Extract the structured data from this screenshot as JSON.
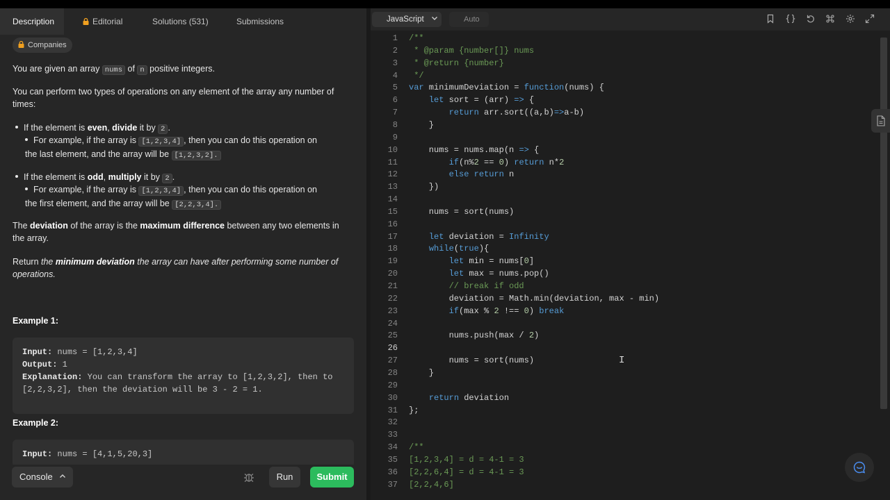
{
  "tabs": {
    "description": "Description",
    "editorial": "Editorial",
    "solutions": "Solutions (531)",
    "submissions": "Submissions"
  },
  "companies": "Companies",
  "problem": {
    "p1_a": "You are given an array ",
    "p1_nums": "nums",
    "p1_b": " of ",
    "p1_n": "n",
    "p1_c": " positive integers.",
    "p2": "You can perform two types of operations on any element of the array any number of times:",
    "b1_a": "If the element is ",
    "b1_even": "even",
    "b1_comma": ", ",
    "b1_divide": "divide",
    "b1_b": " it by ",
    "b1_two": "2",
    "b1_c": ".",
    "b1s_a": "For example, if the array is ",
    "b1s_arr": "[1,2,3,4]",
    "b1s_b": ", then you can do this operation on the last element, and the array will be ",
    "b1s_res": "[1,2,3,2].",
    "b2_a": "If the element is ",
    "b2_odd": "odd",
    "b2_comma": ", ",
    "b2_multiply": "multiply",
    "b2_b": " it by ",
    "b2_two": "2",
    "b2_c": ".",
    "b2s_a": "For example, if the array is ",
    "b2s_arr": "[1,2,3,4]",
    "b2s_b": ", then you can do this operation on the first element, and the array will be ",
    "b2s_res": "[2,2,3,4].",
    "p3_a": "The ",
    "p3_dev": "deviation",
    "p3_b": " of the array is the ",
    "p3_max": "maximum difference",
    "p3_c": " between any two elements in the array.",
    "p4_a": "Return ",
    "p4_the": "the ",
    "p4_min": "minimum deviation",
    "p4_b": " the array can have after performing some number of operations."
  },
  "example1": {
    "title": "Example 1:",
    "input_label": "Input:",
    "input": " nums = [1,2,3,4]",
    "output_label": "Output:",
    "output": " 1",
    "expl_label": "Explanation:",
    "expl": " You can transform the array to [1,2,3,2], then to [2,2,3,2], then the deviation will be 3 - 2 = 1."
  },
  "example2": {
    "title": "Example 2:",
    "input_label": "Input:",
    "input": " nums = [4,1,5,20,3]"
  },
  "bottom": {
    "console": "Console",
    "run": "Run",
    "submit": "Submit"
  },
  "editor": {
    "language": "JavaScript",
    "auto": "Auto"
  },
  "colors": {
    "accent_green": "#2cbb5d",
    "comment": "#6a9955",
    "keyword": "#569cd6",
    "string": "#ce9178"
  },
  "code_lines": [
    "/**",
    " * @param {number[]} nums",
    " * @return {number}",
    " */",
    "var minimumDeviation = function(nums) {",
    "    let sort = (arr) => {",
    "        return arr.sort((a,b)=>a-b)",
    "    }",
    "",
    "    nums = nums.map(n => {",
    "        if(n%2 == 0) return n*2",
    "        else return n",
    "    })",
    "",
    "    nums = sort(nums)",
    "",
    "    let deviation = Infinity",
    "    while(true){",
    "        let min = nums[0]",
    "        let max = nums.pop()",
    "        // break if odd",
    "        deviation = Math.min(deviation, max - min)",
    "        if(max % 2 !== 0) break",
    "",
    "        nums.push(max / 2)",
    "",
    "        nums = sort(nums)",
    "    }",
    "",
    "    return deviation",
    "};",
    "",
    "",
    "/**",
    "[1,2,3,4] = d = 4-1 = 3",
    "[2,2,6,4] = d = 4-1 = 3",
    "[2,2,4,6]"
  ]
}
